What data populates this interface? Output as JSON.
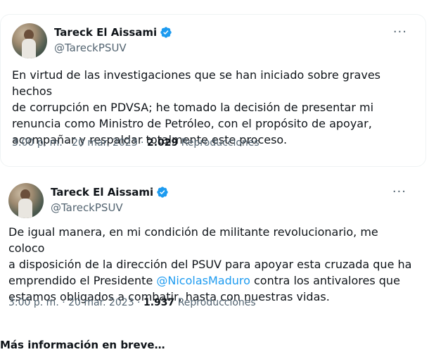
{
  "tweets": [
    {
      "author_name": "Tareck El Aissami",
      "handle": "@TareckPSUV",
      "more_label": "···",
      "text": "En virtud de las investigaciones que se han iniciado sobre graves hechos\nde corrupción en PDVSA; he tomado la decisión de presentar mi\nrenuncia como Ministro de Petróleo, con el propósito de apoyar,\nacompañar y respaldar totalmente este proceso.",
      "time": "3:00 p. m. · 20 mar. 2023 · ",
      "views_count": "2.029",
      "views_label": " Reproducciones"
    },
    {
      "author_name": "Tareck El Aissami",
      "handle": "@TareckPSUV",
      "more_label": "···",
      "text_before_mention": "De igual manera, en mi condición de militante revolucionario, me coloco\na disposición de la dirección del PSUV para apoyar esta cruzada que ha\nemprendido el Presidente ",
      "mention": "@NicolasMaduro",
      "text_after_mention": " contra los antivalores que\nestamos obligados a combatir, hasta con nuestras vidas.",
      "time": "3:00 p. m. · 20 mar. 2023 · ",
      "views_count": "1.937",
      "views_label": " Reproducciones"
    }
  ],
  "footer_text": "Más información en breve…",
  "colors": {
    "verified": "#1d9bf0",
    "mention": "#1d9bf0",
    "secondary_text": "#536471",
    "border": "#eff3f4"
  },
  "icons": {
    "verified": "verified-badge-icon",
    "more": "more-options-icon"
  }
}
